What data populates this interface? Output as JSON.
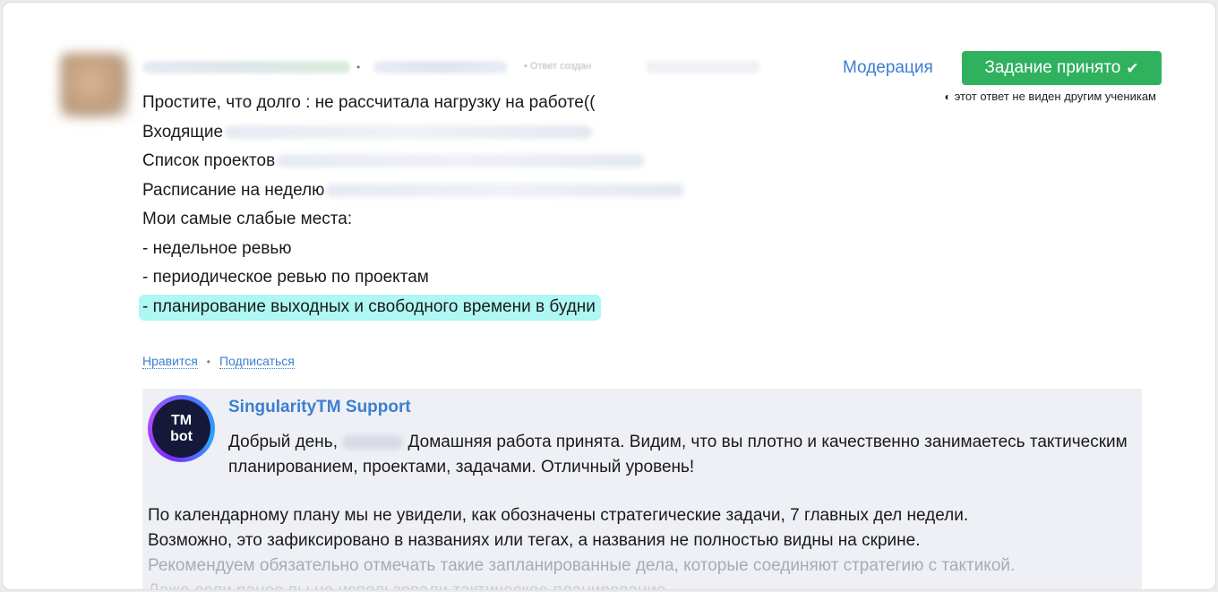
{
  "answer": {
    "lines": [
      "Простите, что долго : не рассчитала нагрузку на работе((",
      "Входящие",
      "Список проектов",
      "Расписание на неделю",
      "Мои самые слабые места:",
      "- недельное ревью",
      "- периодическое ревью по проектам",
      "- планирование выходных и свободного времени в будни"
    ],
    "meta_separator": "•",
    "meta_created_label": "• Ответ создан"
  },
  "header": {
    "moderation_link": "Модерация",
    "accepted_button": "Задание принято",
    "hidden_note": "этот ответ не виден другим ученикам"
  },
  "actions": {
    "like": "Нравится",
    "separator": "•",
    "subscribe": "Подписаться"
  },
  "support": {
    "avatar_line1": "TM",
    "avatar_line2": "bot",
    "name": "SingularityTM Support",
    "greeting_before_name": "Добрый день,",
    "greeting_after_name": "Домашняя работа принята. Видим, что вы плотно и качественно занимаетесь тактическим планированием, проектами, задачами. Отличный уровень!",
    "paragraph_line1": "По календарному плану мы не увидели, как обозначены стратегические задачи, 7 главных дел недели.",
    "paragraph_line2": "Возможно, это зафиксировано в названиях или тегах, а названия не полностью видны на скрине.",
    "paragraph_line3": "Рекомендуем обязательно отмечать такие запланированные дела, которые соединяют стратегию с тактикой.",
    "paragraph_line4": "Даже если ранее вы не использовали тактическое планирование"
  },
  "colors": {
    "accent": "#3d7ed1",
    "accepted_green": "#2fb15e",
    "highlight": "#aef7f3",
    "support_bg": "#eef0f5"
  },
  "icons": {
    "accepted": "check-icon",
    "hidden": "eye-off-icon"
  }
}
